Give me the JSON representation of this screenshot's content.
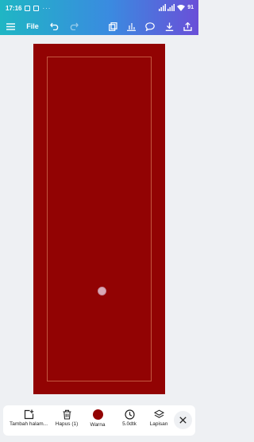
{
  "status": {
    "time": "17:16",
    "dots": "···",
    "battery": "91"
  },
  "toolbar": {
    "file_label": "File",
    "icons": [
      "menu-icon",
      "undo-icon",
      "redo-icon",
      "duplicate-icon",
      "chart-icon",
      "comment-icon",
      "download-icon",
      "share-icon"
    ]
  },
  "canvas": {
    "page_color": "#920303"
  },
  "bottom": {
    "items": [
      {
        "label": "Tambah halam..."
      },
      {
        "label": "Hapus (1)"
      },
      {
        "label": "Warna"
      },
      {
        "label": "5.0dtk"
      },
      {
        "label": "Lapisan"
      }
    ]
  },
  "colors": {
    "accent": "#3a8be0",
    "page": "#920303"
  }
}
